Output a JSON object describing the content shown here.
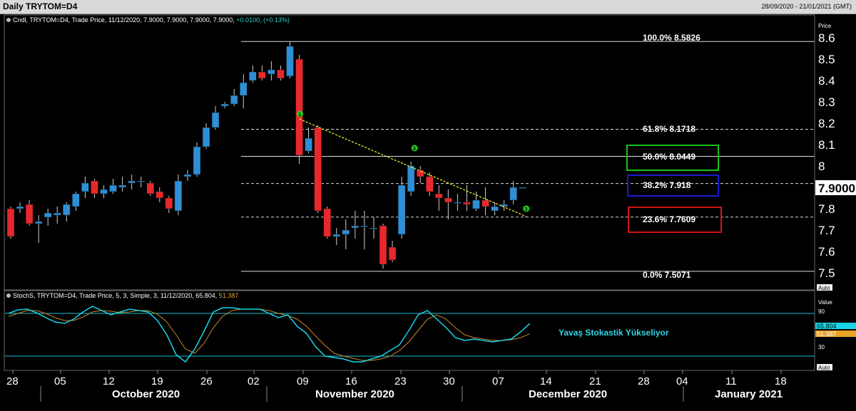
{
  "header": {
    "title": "Daily  TRYTOM=D4",
    "date_range": "28/09/2020 - 21/01/2021 (GMT)"
  },
  "price_panel": {
    "legend": "Cndl, TRYTOM=D4, Trade Price, 11/12/2020, 7.9000, 7.9000, 7.9000, 7.9000, ",
    "legend_change": "+0.0100, (+0.13%)",
    "axis_title": "Price",
    "last_price": "7.9000",
    "auto_label": "Auto"
  },
  "stoch_panel": {
    "legend": "StochS, TRYTOM=D4, Trade Price,  5, 3, Simple, 3, 11/12/2020, 65.804, ",
    "legend_value2": "51.387",
    "axis_title": "Value",
    "tag_k": "65.804",
    "tag_d": "51.387",
    "annotation": "Yavaş Stokastik Yükseliyor",
    "auto_label": "Auto"
  },
  "fib_labels": {
    "f100": "100.0%  8.5826",
    "f618": "61.8%    8.1718",
    "f500": "50.0%    8.0449",
    "f382": "38.2%    7.918",
    "f236": "23.6%    7.7609",
    "f000": "0.0%      7.5071"
  },
  "wave_markers": [
    "1",
    "2",
    "3"
  ],
  "colors": {
    "up": "#2e8fd6",
    "down": "#e8282d",
    "stoch_k": "#18d6e6",
    "stoch_d": "#c8862a",
    "trendline": "#ffff33",
    "box_50": "#17c217",
    "box_382": "#1a1acf",
    "box_236": "#d11515"
  },
  "chart_data": [
    {
      "type": "candlestick",
      "title": "Daily TRYTOM=D4",
      "ylabel": "Price",
      "ylim": [
        7.46,
        8.68
      ],
      "yticks": [
        "7.5",
        "7.6",
        "7.7",
        "7.8",
        "7.9",
        "8",
        "8.1",
        "8.2",
        "8.3",
        "8.4",
        "8.5",
        "8.6"
      ],
      "x_ticks": [
        "28",
        "05",
        "12",
        "19",
        "26",
        "02",
        "09",
        "16",
        "23",
        "30",
        "07",
        "14",
        "21",
        "28",
        "04",
        "11",
        "18"
      ],
      "months": [
        "October 2020",
        "November 2020",
        "December 2020",
        "January 2021"
      ],
      "fibonacci": [
        {
          "level": "100.0%",
          "price": 8.5826
        },
        {
          "level": "61.8%",
          "price": 8.1718
        },
        {
          "level": "50.0%",
          "price": 8.0449
        },
        {
          "level": "38.2%",
          "price": 7.918
        },
        {
          "level": "23.6%",
          "price": 7.7609
        },
        {
          "level": "0.0%",
          "price": 7.5071
        }
      ],
      "trendline": {
        "from": {
          "bar": 31,
          "price": 8.22
        },
        "to": {
          "bar": 54,
          "price": 7.78
        }
      },
      "candles": [
        [
          7.8,
          7.67,
          7.81,
          7.66
        ],
        [
          7.8,
          7.81,
          7.83,
          7.78
        ],
        [
          7.82,
          7.73,
          7.84,
          7.72
        ],
        [
          7.73,
          7.74,
          7.77,
          7.64
        ],
        [
          7.76,
          7.78,
          7.8,
          7.72
        ],
        [
          7.77,
          7.78,
          7.81,
          7.73
        ],
        [
          7.77,
          7.82,
          7.83,
          7.74
        ],
        [
          7.81,
          7.87,
          7.88,
          7.79
        ],
        [
          7.88,
          7.92,
          7.95,
          7.85
        ],
        [
          7.93,
          7.87,
          7.94,
          7.85
        ],
        [
          7.87,
          7.89,
          7.91,
          7.85
        ],
        [
          7.88,
          7.91,
          7.94,
          7.87
        ],
        [
          7.9,
          7.91,
          7.95,
          7.88
        ],
        [
          7.92,
          7.93,
          7.96,
          7.89
        ],
        [
          7.93,
          7.93,
          7.95,
          7.9
        ],
        [
          7.92,
          7.87,
          7.93,
          7.86
        ],
        [
          7.88,
          7.85,
          7.9,
          7.83
        ],
        [
          7.85,
          7.8,
          7.86,
          7.78
        ],
        [
          7.79,
          7.93,
          7.96,
          7.77
        ],
        [
          7.95,
          7.96,
          7.98,
          7.93
        ],
        [
          7.96,
          8.09,
          8.11,
          7.95
        ],
        [
          8.09,
          8.18,
          8.2,
          8.08
        ],
        [
          8.18,
          8.25,
          8.28,
          8.17
        ],
        [
          8.28,
          8.29,
          8.3,
          8.27
        ],
        [
          8.29,
          8.33,
          8.36,
          8.28
        ],
        [
          8.33,
          8.39,
          8.43,
          8.27
        ],
        [
          8.4,
          8.44,
          8.47,
          8.39
        ],
        [
          8.44,
          8.41,
          8.47,
          8.4
        ],
        [
          8.43,
          8.45,
          8.49,
          8.4
        ],
        [
          8.45,
          8.41,
          8.47,
          8.4
        ],
        [
          8.42,
          8.56,
          8.58,
          8.41
        ],
        [
          8.5,
          8.05,
          8.52,
          8.01
        ],
        [
          8.07,
          8.13,
          8.18,
          8.06
        ],
        [
          8.18,
          7.79,
          8.19,
          7.78
        ],
        [
          7.8,
          7.67,
          7.81,
          7.66
        ],
        [
          7.67,
          7.68,
          7.71,
          7.63
        ],
        [
          7.68,
          7.7,
          7.75,
          7.61
        ],
        [
          7.71,
          7.72,
          7.79,
          7.66
        ],
        [
          7.72,
          7.72,
          7.79,
          7.61
        ],
        [
          7.71,
          7.71,
          7.76,
          7.66
        ],
        [
          7.72,
          7.54,
          7.73,
          7.52
        ],
        [
          7.62,
          7.56,
          7.65,
          7.55
        ],
        [
          7.68,
          7.91,
          7.95,
          7.66
        ],
        [
          7.88,
          8.0,
          8.02,
          7.86
        ],
        [
          7.98,
          7.95,
          8.0,
          7.92
        ],
        [
          7.95,
          7.88,
          7.97,
          7.86
        ],
        [
          7.87,
          7.85,
          7.91,
          7.79
        ],
        [
          7.85,
          7.83,
          7.89,
          7.75
        ],
        [
          7.83,
          7.83,
          7.87,
          7.79
        ],
        [
          7.83,
          7.82,
          7.91,
          7.79
        ],
        [
          7.8,
          7.84,
          7.88,
          7.79
        ],
        [
          7.84,
          7.81,
          7.9,
          7.77
        ],
        [
          7.79,
          7.81,
          7.83,
          7.77
        ],
        [
          7.81,
          7.82,
          7.84,
          7.79
        ],
        [
          7.84,
          7.9,
          7.93,
          7.82
        ],
        [
          7.9,
          7.9,
          7.9,
          7.9
        ]
      ]
    },
    {
      "type": "line",
      "title": "StochS, TRYTOM=D4, Trade Price, 5, 3, Simple, 3",
      "ylabel": "Value",
      "ylim": [
        0,
        100
      ],
      "reference_lines": [
        80,
        20
      ],
      "yticks": [
        "90",
        "30"
      ],
      "series": [
        {
          "name": "StochS %K",
          "values": [
            80,
            85,
            86,
            81,
            74,
            68,
            66,
            72,
            82,
            90,
            84,
            78,
            82,
            86,
            84,
            82,
            70,
            50,
            22,
            12,
            30,
            55,
            82,
            88,
            88,
            86,
            86,
            86,
            80,
            74,
            78,
            62,
            52,
            33,
            20,
            18,
            16,
            12,
            12,
            16,
            20,
            28,
            36,
            56,
            78,
            84,
            72,
            60,
            46,
            42,
            44,
            42,
            40,
            42,
            44,
            54,
            65.8
          ]
        },
        {
          "name": "StochS %D",
          "values": [
            76,
            80,
            84,
            84,
            80,
            74,
            70,
            70,
            75,
            82,
            84,
            83,
            81,
            82,
            84,
            84,
            79,
            68,
            50,
            30,
            24,
            38,
            60,
            76,
            84,
            86,
            86,
            86,
            84,
            80,
            77,
            72,
            62,
            48,
            35,
            24,
            20,
            17,
            14,
            14,
            16,
            20,
            28,
            40,
            56,
            72,
            78,
            72,
            60,
            50,
            46,
            44,
            42,
            42,
            43,
            46,
            51.4
          ]
        }
      ]
    }
  ]
}
